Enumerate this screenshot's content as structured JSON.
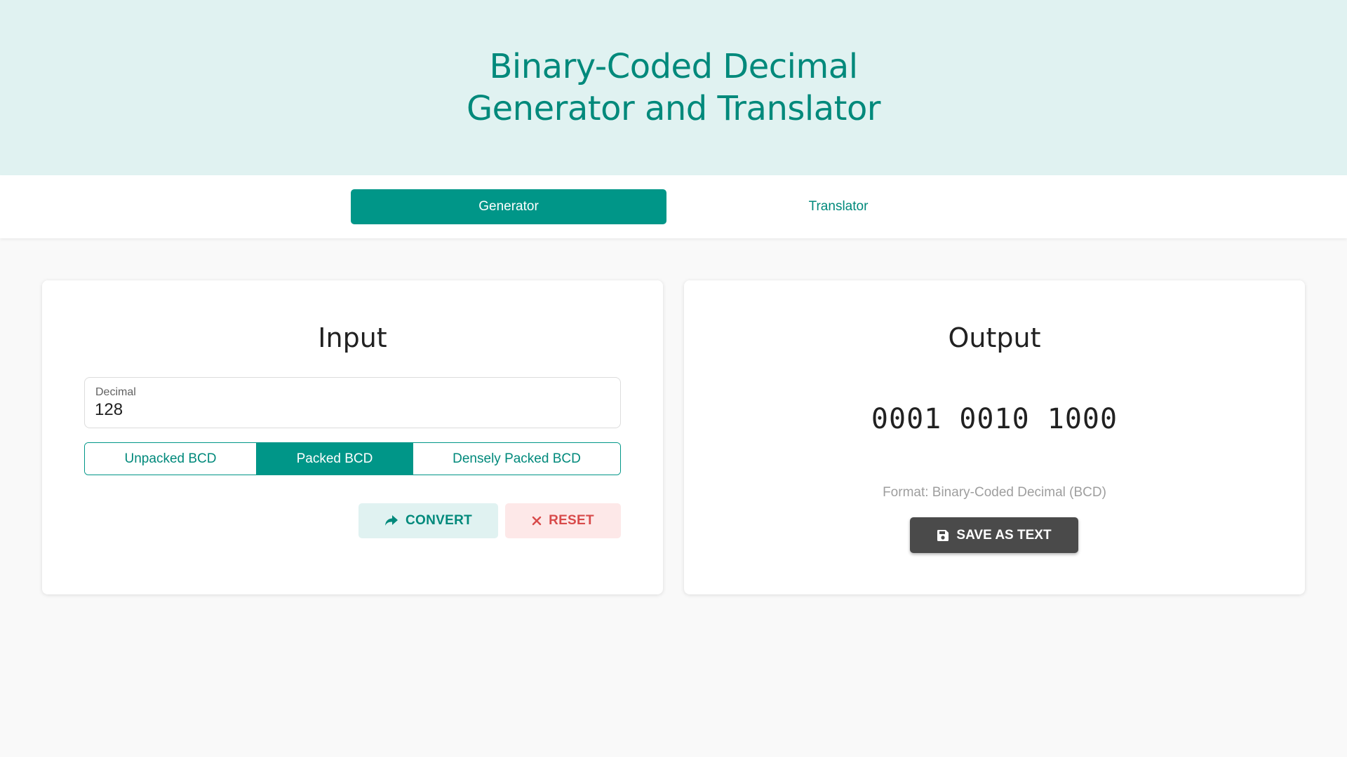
{
  "header": {
    "title_line1": "Binary-Coded Decimal",
    "title_line2": "Generator and Translator"
  },
  "tabs": [
    {
      "label": "Generator",
      "active": true
    },
    {
      "label": "Translator",
      "active": false
    }
  ],
  "input_card": {
    "heading": "Input",
    "decimal_field": {
      "label": "Decimal",
      "value": "128"
    },
    "modes": [
      {
        "label": "Unpacked BCD",
        "active": false
      },
      {
        "label": "Packed BCD",
        "active": true
      },
      {
        "label": "Densely Packed BCD",
        "active": false
      }
    ],
    "convert_label": "CONVERT",
    "convert_icon": "share-arrow-icon",
    "reset_label": "RESET",
    "reset_icon": "close-icon"
  },
  "output_card": {
    "heading": "Output",
    "value": "0001 0010 1000",
    "format_text": "Format: Binary-Coded Decimal (BCD)",
    "save_label": "SAVE AS TEXT",
    "save_icon": "floppy-disk-icon"
  },
  "colors": {
    "accent": "#009688",
    "accent_text": "#00897b",
    "hero_bg": "#e0f2f1",
    "reset": "#d84a4a",
    "save_bg": "#4a4a4a"
  }
}
